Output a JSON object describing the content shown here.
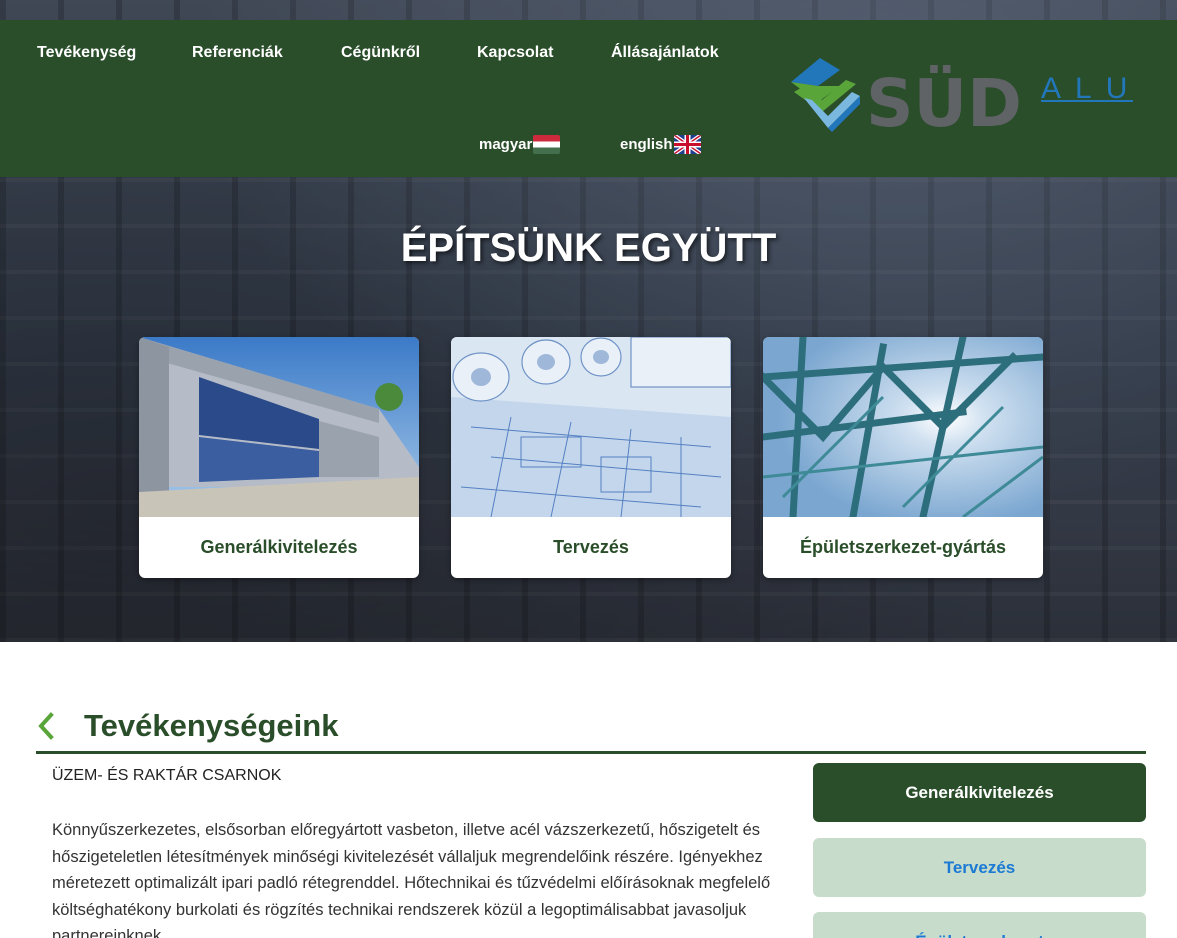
{
  "nav": {
    "items": [
      {
        "label": "Tevékenység"
      },
      {
        "label": "Referenciák"
      },
      {
        "label": "Cégünkről"
      },
      {
        "label": "Kapcsolat"
      },
      {
        "label": "Állásajánlatok"
      }
    ]
  },
  "languages": [
    {
      "label": "magyar",
      "flag": "hungary-flag-icon"
    },
    {
      "label": "english",
      "flag": "uk-flag-icon"
    }
  ],
  "logo": {
    "main": "SÜD",
    "sub": "ALU"
  },
  "hero": {
    "title": "ÉPÍTSÜNK EGYÜTT"
  },
  "cards": [
    {
      "label": "Generálkivitelezés",
      "image": "industrial-hall-image"
    },
    {
      "label": "Tervezés",
      "image": "blueprints-image"
    },
    {
      "label": "Épületszerkezet-gyártás",
      "image": "steel-structure-image"
    }
  ],
  "section": {
    "title": "Tevékenységeink",
    "subtitle": "ÜZEM- ÉS RAKTÁR CSARNOK",
    "body": "Könnyűszerkezetes, elsősorban előregyártott vasbeton, illetve acél vázszerkezetű, hőszigetelt és hőszigeteletlen létesítmények minőségi kivitelezését vállaljuk megrendelőink részére. Igényekhez méretezett optimalizált ipari padló rétegrenddel. Hőtechnikai és tűzvédelmi előírásoknak megfelelő költséghatékony burkolati és rögzítés technikai rendszerek közül a legoptimálisabbat javasoljuk partnereinknek."
  },
  "sidebar": {
    "buttons": [
      {
        "label": "Generálkivitelezés",
        "active": true
      },
      {
        "label": "Tervezés",
        "active": false
      },
      {
        "label": "Épületszerkezet",
        "active": false
      }
    ]
  },
  "colors": {
    "header_green": "#2a4d2a",
    "inactive_button": "#c8dccc",
    "link_blue": "#1a7ad4",
    "logo_gray": "#5f6366",
    "logo_blue": "#2277bb",
    "logo_green": "#5aa53a"
  }
}
